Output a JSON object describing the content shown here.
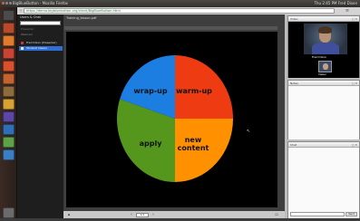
{
  "top_panel": {
    "title": "BigBlueButton - Mozilla Firefox",
    "status": "Thu 2:45 PM  Fred Dixon"
  },
  "address_bar": {
    "url": "https://demo.bigbluebutton.org/client/BigBlueButton.html"
  },
  "chat_panel": {
    "header": "Users & Chat",
    "subtitle": "Presenter",
    "subtitle2": "Webcam",
    "rows": [
      {
        "label": "Fred Dixon (Presenter)",
        "active": false,
        "color": "#cc3a2b"
      },
      {
        "label": "Student Viewer",
        "active": true,
        "color": "#e6e6e6"
      }
    ]
  },
  "presentation": {
    "title": "Training_lesson.pdf",
    "page": "1/1"
  },
  "chart_data": {
    "type": "pie",
    "title": "",
    "slices": [
      {
        "name": "warm-up",
        "value": 25,
        "color": "#ee3b11"
      },
      {
        "name": "new content",
        "value": 25,
        "color": "#ff9100"
      },
      {
        "name": "apply",
        "value": 30,
        "color": "#55971c"
      },
      {
        "name": "wrap-up",
        "value": 20,
        "color": "#1b7ee0"
      }
    ]
  },
  "pie_labels": {
    "warmup": "warm-up",
    "new_content_1": "new",
    "new_content_2": "content",
    "apply": "apply",
    "wrapup": "wrap-up"
  },
  "right_panels": {
    "video_title": "Video",
    "camera_name": "Fred Dixon",
    "small_camera_name": "Viewer",
    "notes_title": "Notes",
    "chat_title": "Chat",
    "send_label": "Send"
  },
  "colors": {
    "accent": "#2f6fd5",
    "slide_background": "#000000"
  }
}
